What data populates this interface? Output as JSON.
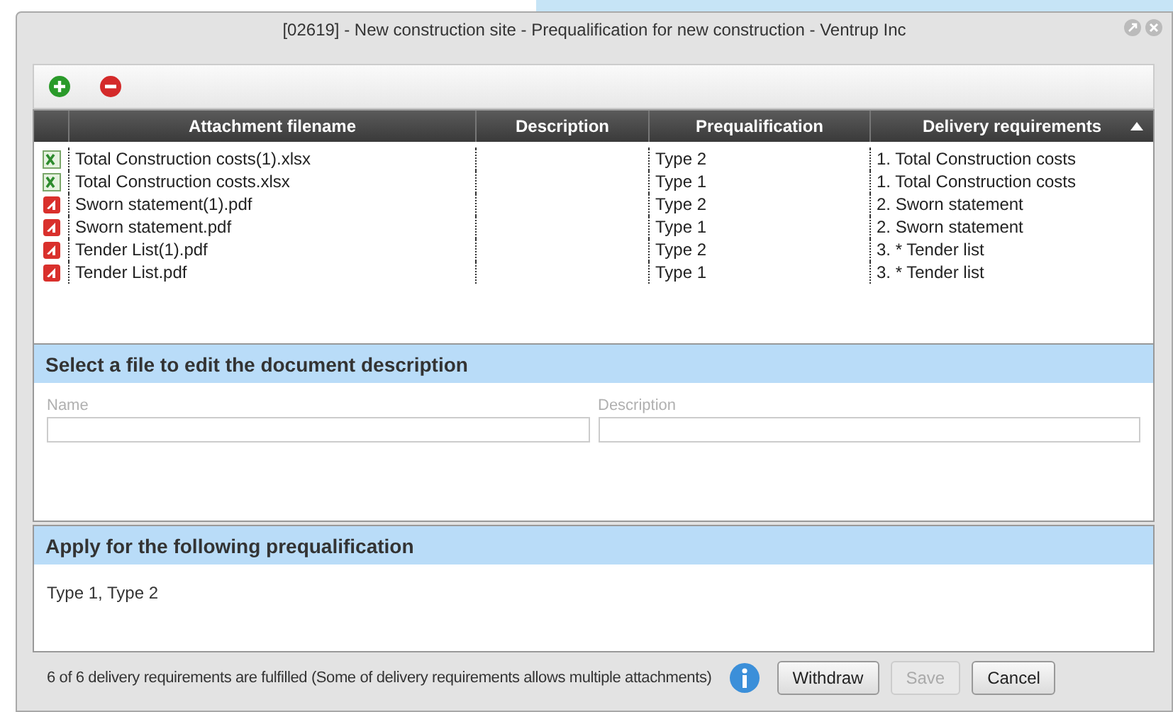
{
  "window": {
    "title": "[02619] - New construction site - Prequalification for new construction - Ventrup Inc"
  },
  "toolbar": [
    {
      "kind": "add"
    },
    {
      "kind": "remove"
    }
  ],
  "table": {
    "columns": [
      {
        "label": "Attachment filename",
        "sorted": false
      },
      {
        "label": "Description",
        "sorted": false
      },
      {
        "label": "Prequalification",
        "sorted": false
      },
      {
        "label": "Delivery requirements",
        "sorted": true
      }
    ],
    "rows": [
      {
        "kind": "xlsx",
        "filename": "Total Construction costs(1).xlsx",
        "prequalification": "Type 2",
        "requirement": "1. Total Construction costs"
      },
      {
        "kind": "xlsx",
        "filename": "Total Construction costs.xlsx",
        "prequalification": "Type 1",
        "requirement": "1. Total Construction costs"
      },
      {
        "kind": "pdf",
        "filename": "Sworn statement(1).pdf",
        "prequalification": "Type 2",
        "requirement": "2. Sworn statement"
      },
      {
        "kind": "pdf",
        "filename": "Sworn statement.pdf",
        "prequalification": "Type 1",
        "requirement": "2. Sworn statement"
      },
      {
        "kind": "pdf",
        "filename": "Tender List(1).pdf",
        "prequalification": "Type 2",
        "requirement": "3. * Tender list"
      },
      {
        "kind": "pdf",
        "filename": "Tender List.pdf",
        "prequalification": "Type 1",
        "requirement": "3. * Tender list"
      }
    ]
  },
  "edit_section": {
    "title": "Select a file to edit the document description",
    "fields": [
      {
        "label": "Name",
        "disabled": true
      },
      {
        "label": "Description",
        "disabled": true
      }
    ]
  },
  "prequalification_section": {
    "title": "Apply for the following prequalification",
    "text": "Type 1, Type 2"
  },
  "status": {
    "text": "6 of 6 delivery requirements are fulfilled (Some of delivery requirements allows multiple attachments)"
  },
  "buttons": [
    {
      "label": "Withdraw",
      "disabled": false
    },
    {
      "label": "Save",
      "disabled": true
    },
    {
      "label": "Cancel",
      "disabled": false
    }
  ]
}
